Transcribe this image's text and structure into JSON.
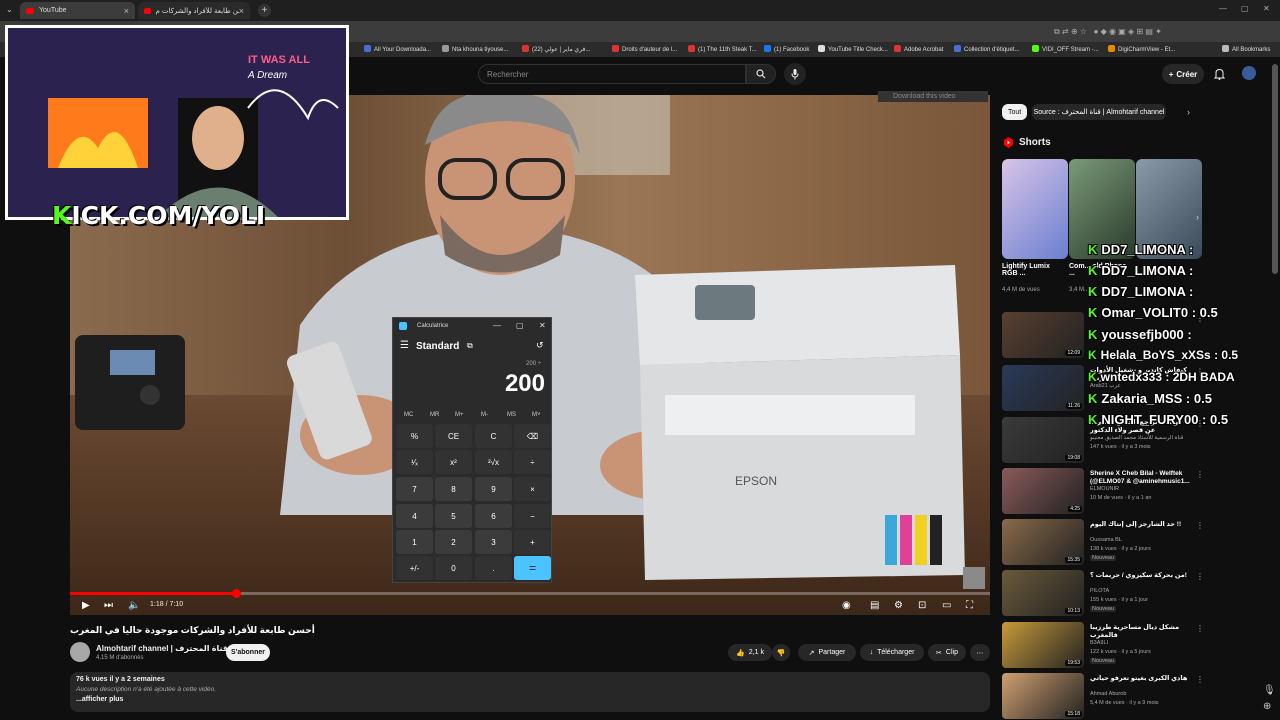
{
  "browser": {
    "tabs": [
      {
        "label": "YouTube",
        "close": "×"
      },
      {
        "label": "أحسن طابعة للأفراد والشركات م...",
        "close": "×"
      }
    ],
    "new_tab": "+",
    "window_controls": [
      "—",
      "▢",
      "✕"
    ],
    "bookmarks": [
      {
        "label": "All Your Downloada...",
        "color": "#4a6cd4"
      },
      {
        "label": "Nta khouna tiyouse...",
        "color": "#9a9a9a"
      },
      {
        "label": "(22) فري ماير | عولي...",
        "color": "#d33"
      },
      {
        "label": "Droits d'auteur de l...",
        "color": "#d33"
      },
      {
        "label": "(1) The 11th Steak T...",
        "color": "#d33"
      },
      {
        "label": "(1) Facebook",
        "color": "#1877f2"
      },
      {
        "label": "YouTube Title Check...",
        "color": "#ddd"
      },
      {
        "label": "Adobe Acrobat",
        "color": "#d33"
      },
      {
        "label": "Collection d'étiquet...",
        "color": "#4a6cd4"
      },
      {
        "label": "VIDI_OFF Stream -...",
        "color": "#53fc18"
      },
      {
        "label": "DigiCharmView - Et...",
        "color": "#e68a00"
      },
      {
        "label": "All Bookmarks",
        "color": "#bbb"
      }
    ]
  },
  "header": {
    "search_placeholder": "Rechercher",
    "create_label": "Créer",
    "create_icon": "+"
  },
  "overlay": {
    "kick_k": "K",
    "kick_rest": "ICK.COM/YOLI",
    "webcam_sign_1": "IT WAS ALL",
    "webcam_sign_2": "A Dream",
    "download_video": "Download this video"
  },
  "calculator": {
    "title": "Calculatrice",
    "mode": "Standard",
    "expression": "200 ÷",
    "display": "200",
    "memory": [
      "MC",
      "MR",
      "M+",
      "M-",
      "MS",
      "M˅"
    ],
    "keys": [
      [
        "%",
        "CE",
        "C",
        "⌫"
      ],
      [
        "¹⁄ₓ",
        "x²",
        "²√x",
        "÷"
      ],
      [
        "7",
        "8",
        "9",
        "×"
      ],
      [
        "4",
        "5",
        "6",
        "−"
      ],
      [
        "1",
        "2",
        "3",
        "+"
      ],
      [
        "+/-",
        "0",
        ".",
        "="
      ]
    ]
  },
  "player": {
    "time": "1:18 / 7:10",
    "progress": 0.18
  },
  "video": {
    "title": "أحسن طابعة للأفراد والشركات موجودة حاليا في المغرب",
    "channel": "Almohtarif channel | قناة المحترف",
    "subscribers": "4,15 M d'abonnés",
    "subscribe": "S'abonner",
    "likes": "2,1 k",
    "share": "Partager",
    "download": "Télécharger",
    "clip": "Clip",
    "more": "⋯",
    "desc_views": "76 k vues  il y a 2 semaines",
    "desc_text": "Aucune description n'a été ajoutée à cette vidéo.",
    "desc_more": "...afficher plus"
  },
  "sidebar": {
    "chips": [
      "Tout",
      "Source : قناة المحترف | Almohtarif channel"
    ],
    "shorts_title": "Shorts",
    "shorts": [
      {
        "title": "Lightify Lumix RGB ...",
        "views": "4,4 M de vues"
      },
      {
        "title": "Com... old Phone ...",
        "views": "3,4 M..."
      }
    ],
    "recommended": [
      {
        "title": "",
        "channel": "",
        "views": "",
        "duration": "12:09"
      },
      {
        "title": "كيفاش كاتدير و تشغيل الأدوات في الإنترنت",
        "channel": "Arab21 عرب",
        "views": "",
        "duration": "11:26"
      },
      {
        "title": "...ولماذا تراجع الحسن الثاني عن قصر ولاء الدكتور",
        "channel": "قناة الرسمية للأستاذ محمد الصديق معنينو",
        "views": "147 k vues · il y a 3 mois",
        "duration": "19:08"
      },
      {
        "title": "Sherine X Cheb Bilal - Welftek (@ELMO07 & @aminehmusic1...",
        "channel": "ELMOUNIR",
        "views": "10 M de vues · il y a 1 an",
        "duration": "4:25"
      },
      {
        "title": "حد الشارجر إلى إنتاك اليوم !!",
        "channel": "Oussama BL",
        "views": "138 k vues · il y a 2 jours",
        "duration": "15:35",
        "badge": "Nouveau"
      },
      {
        "title": "من بحركة سكيزوي / حريمات ؟!",
        "channel": "PILOTA",
        "views": "155 k vues · il y a 1 jour",
        "duration": "10:13",
        "badge": "Nouveau"
      },
      {
        "title": "مشكل ديال مساحرية طرزيبا فالمغرب",
        "channel": "B3A9LI",
        "views": "122 k vues · il y a 5 jours",
        "duration": "19:53",
        "badge": "Nouveau"
      },
      {
        "title": "هادي الكبرى بغيتو تعرفو حياتي",
        "channel": "Ahmad Aburob",
        "views": "5,4 M de vues · il y a 9 mois",
        "duration": "15:18"
      }
    ]
  },
  "chat": [
    {
      "k": "K",
      "text": "DD7_LIMONA :"
    },
    {
      "k": "K",
      "text": "DD7_LIMONA :"
    },
    {
      "k": "K",
      "text": "DD7_LIMONA :"
    },
    {
      "k": "K",
      "text": "Omar_VOLIT0 : 0.5"
    },
    {
      "k": "K",
      "text": "youssefjb000 :"
    },
    {
      "k": "K",
      "text": "Helala_BoYS_xXSs : 0.5"
    },
    {
      "k": "K",
      "text": "wntedx333 : 2DH BADA"
    },
    {
      "k": "K",
      "text": "Zakaria_MSS : 0.5"
    },
    {
      "k": "K",
      "text": "NIGHT_FURY00 : 0.5"
    }
  ],
  "colors": {
    "accent": "#ff0000",
    "kick": "#53fc18",
    "calc_eq": "#4cc2ff"
  }
}
